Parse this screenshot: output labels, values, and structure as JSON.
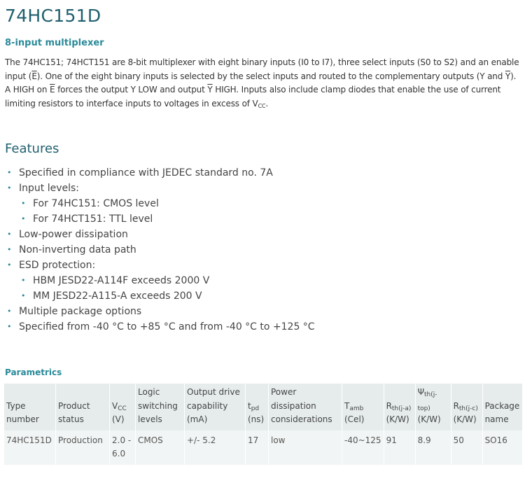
{
  "product": {
    "title": "74HC151D",
    "subtitle": "8-input multiplexer"
  },
  "description": {
    "p1": "The 74HC151; 74HCT151 are 8-bit multiplexer with eight binary inputs (I0 to I7), three select inputs (S0 to S2) and an enable input (",
    "e1": "E",
    "p2": "). One of the eight binary inputs is selected by the select inputs and routed to the complementary outputs (Y and ",
    "y1": "Y",
    "p3": "). A HIGH on ",
    "e2": "E",
    "p4": " forces the output Y LOW and output ",
    "y2": "Y",
    "p5": " HIGH. Inputs also include clamp diodes that enable the use of current limiting resistors to interface inputs to voltages in excess of V",
    "vcc_sub": "CC",
    "end": "."
  },
  "features": {
    "heading": "Features",
    "bullet_glyph": "•",
    "items": [
      "Specified in compliance with JEDEC standard no. 7A",
      "Input levels:",
      "For 74HC151: CMOS level",
      "For 74HCT151: TTL level",
      "Low-power dissipation",
      "Non-inverting data path",
      "ESD protection:",
      "HBM JESD22-A114F exceeds 2000 V",
      "MM JESD22-A115-A exceeds 200 V",
      "Multiple package options",
      "Specified from -40 °C to +85 °C and from -40 °C to +125 °C"
    ]
  },
  "parametrics": {
    "heading": "Parametrics",
    "headers": {
      "type_number": "Type number",
      "product_status": "Product status",
      "vcc": "V",
      "vcc_sub": "CC",
      "vcc_unit": "(V)",
      "logic": "Logic switching levels",
      "output_drive": "Output drive capability (mA)",
      "tpd": "t",
      "tpd_sub": "pd",
      "tpd_unit": "(ns)",
      "power": "Power dissipation considerations",
      "tamb": "T",
      "tamb_sub": "amb",
      "tamb_unit": "(Cel)",
      "rthja": "R",
      "rthja_sub": "th(j-a)",
      "rthja_unit": "(K/W)",
      "psi": "Ψ",
      "psi_sub": "th(j-top)",
      "psi_unit": "(K/W)",
      "rthjc": "R",
      "rthjc_sub": "th(j-c)",
      "rthjc_unit": "(K/W)",
      "package": "Package name"
    },
    "row": {
      "type_number": "74HC151D",
      "product_status": "Production",
      "vcc": "2.0 - 6.0",
      "logic": "CMOS",
      "output_drive": "+/- 5.2",
      "tpd": "17",
      "power": "low",
      "tamb": "-40~125",
      "rthja": "91",
      "psi": "8.9",
      "rthjc": "50",
      "package": "SO16"
    }
  },
  "colors": {
    "heading": "#1f5f6e",
    "accent": "#2a8a99",
    "table_header_bg": "#e6ecec",
    "table_cell_bg": "#f2f5f5"
  }
}
